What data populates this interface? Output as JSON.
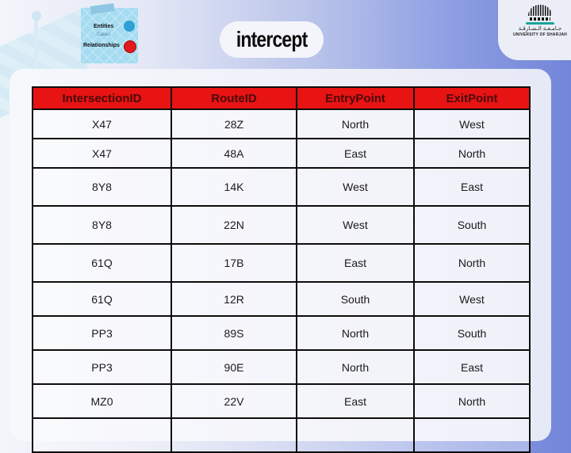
{
  "header": {
    "title": "intercept",
    "er_logo": {
      "entities_label": "Entities",
      "sub_label": "Cases",
      "relationships_label": "Relationships",
      "entity_color": "#2f9fd6",
      "relationship_color": "#e11b1b"
    },
    "university_logo": {
      "arabic_name": "جـامـعـة الـشـارقـة",
      "english_name": "UNIVERSITY OF SHARJAH"
    }
  },
  "table": {
    "header_color": "#e81313",
    "columns": [
      "IntersectionID",
      "RouteID",
      "EntryPoint",
      "ExitPoint"
    ],
    "rows": [
      [
        "X47",
        "28Z",
        "North",
        "West"
      ],
      [
        "X47",
        "48A",
        "East",
        "North"
      ],
      [
        "8Y8",
        "14K",
        "West",
        "East"
      ],
      [
        "8Y8",
        "22N",
        "West",
        "South"
      ],
      [
        "61Q",
        "17B",
        "East",
        "North"
      ],
      [
        "61Q",
        "12R",
        "South",
        "West"
      ],
      [
        "PP3",
        "89S",
        "North",
        "South"
      ],
      [
        "PP3",
        "90E",
        "North",
        "East"
      ],
      [
        "MZ0",
        "22V",
        "East",
        "North"
      ],
      [
        "",
        "",
        "",
        ""
      ]
    ]
  }
}
